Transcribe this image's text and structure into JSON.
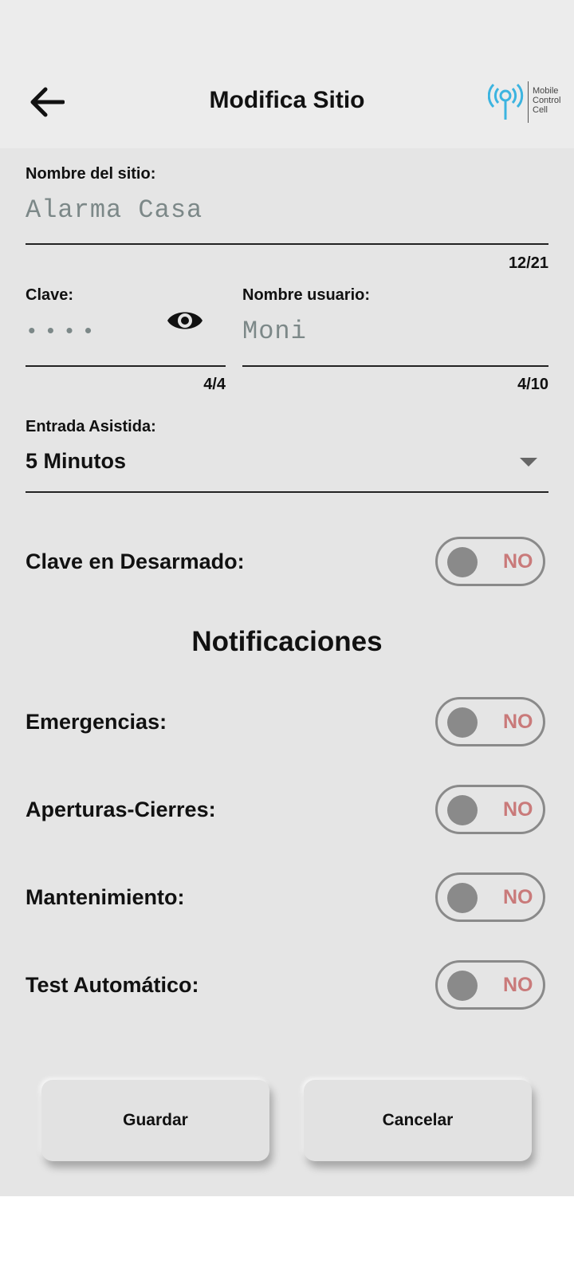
{
  "header": {
    "title": "Modifica Sitio",
    "logo_lines": [
      "Mobile",
      "Control",
      "Cell"
    ]
  },
  "form": {
    "site_name": {
      "label": "Nombre del sitio:",
      "value": "Alarma Casa",
      "counter": "12/21"
    },
    "password": {
      "label": "Clave:",
      "value": "••••",
      "counter": "4/4"
    },
    "username": {
      "label": "Nombre usuario:",
      "value": "Moni",
      "counter": "4/10"
    },
    "assisted_entry": {
      "label": "Entrada Asistida:",
      "value": "5 Minutos"
    },
    "disarm_key": {
      "label": "Clave en Desarmado:",
      "toggle": "NO"
    }
  },
  "notifications": {
    "title": "Notificaciones",
    "items": [
      {
        "label": "Emergencias:",
        "toggle": "NO"
      },
      {
        "label": "Aperturas-Cierres:",
        "toggle": "NO"
      },
      {
        "label": "Mantenimiento:",
        "toggle": "NO"
      },
      {
        "label": "Test Automático:",
        "toggle": "NO"
      }
    ]
  },
  "actions": {
    "save": "Guardar",
    "cancel": "Cancelar"
  },
  "colors": {
    "header_bg": "#ececec",
    "content_bg": "#e5e5e5",
    "toggle_off_text": "#c97a7a",
    "logo_accent": "#3cb4e0"
  }
}
